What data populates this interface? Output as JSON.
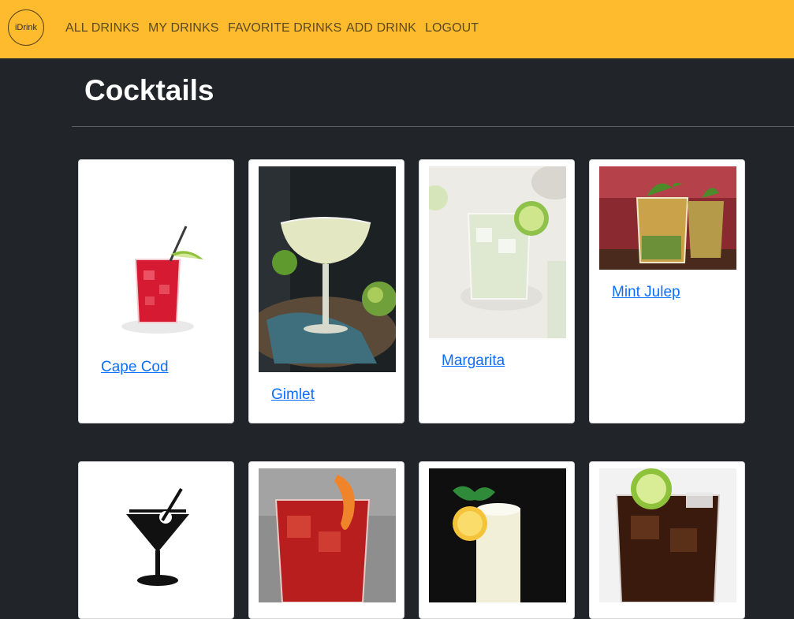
{
  "navbar": {
    "logo_text": "iDrink",
    "links": [
      "ALL DRINKS",
      "MY DRINKS",
      "FAVORITE DRINKS",
      "ADD DRINK",
      "LOGOUT"
    ]
  },
  "page": {
    "title": "Cocktails"
  },
  "drinks": [
    {
      "name": "Cape Cod",
      "image": "red-cocktail-with-lime-photo"
    },
    {
      "name": "Gimlet",
      "image": "coupe-glass-cocktail-photo"
    },
    {
      "name": "Margarita",
      "image": "margarita-on-rocks-photo"
    },
    {
      "name": "Mint Julep",
      "image": "mint-julep-glasses-photo"
    },
    {
      "name": "",
      "image": "martini-glass-icon"
    },
    {
      "name": "",
      "image": "negroni-orange-peel-photo"
    },
    {
      "name": "",
      "image": "fizz-cocktail-lemon-photo"
    },
    {
      "name": "",
      "image": "cola-drink-with-lime-photo"
    }
  ],
  "colors": {
    "navbar": "#fdbb2d",
    "background": "#212529",
    "link": "#0d6efd"
  }
}
